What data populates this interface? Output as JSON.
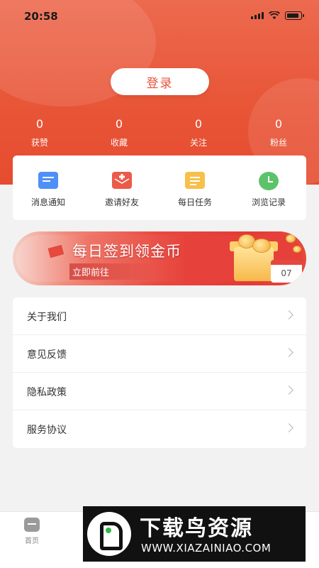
{
  "status_bar": {
    "time": "20:58"
  },
  "header": {
    "login_label": "登录"
  },
  "stats": [
    {
      "value": "0",
      "label": "获赞"
    },
    {
      "value": "0",
      "label": "收藏"
    },
    {
      "value": "0",
      "label": "关注"
    },
    {
      "value": "0",
      "label": "粉丝"
    }
  ],
  "quick_actions": [
    {
      "label": "消息通知",
      "icon": "message-icon",
      "color": "#4f8ff7"
    },
    {
      "label": "邀请好友",
      "icon": "invite-icon",
      "color": "#ec5a4a"
    },
    {
      "label": "每日任务",
      "icon": "task-icon",
      "color": "#f7c04a"
    },
    {
      "label": "浏览记录",
      "icon": "history-icon",
      "color": "#5cc36a"
    }
  ],
  "banner": {
    "title": "每日签到领金币",
    "subtitle": "立即前往",
    "calendar_day": "07"
  },
  "menu": [
    {
      "label": "关于我们"
    },
    {
      "label": "意见反馈"
    },
    {
      "label": "隐私政策"
    },
    {
      "label": "服务协议"
    }
  ],
  "tabbar": {
    "home_label": "首页"
  },
  "watermark": {
    "title": "下载鸟资源",
    "url": "WWW.XIAZAINIAO.COM"
  },
  "colors": {
    "brand": "#e8543a",
    "background": "#f2f2f2"
  }
}
